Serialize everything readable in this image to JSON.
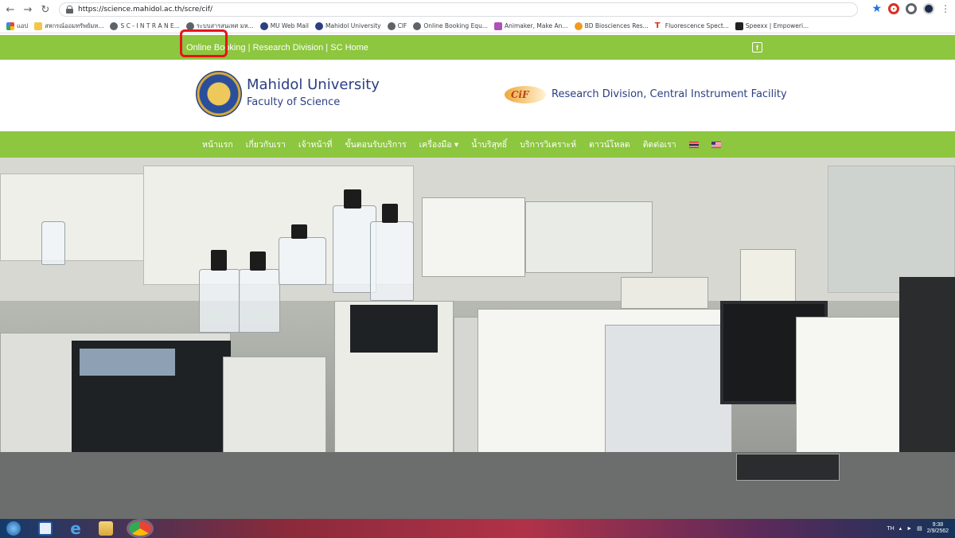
{
  "browser": {
    "url": "https://science.mahidol.ac.th/scre/cif/",
    "bookmarks": [
      "แอป",
      "สหกรณ์ออมทรัพย์มห...",
      "S C - I N T R A N E...",
      "ระบบสารสนเทศ มห...",
      "MU Web Mail",
      "Mahidol University",
      "CIF",
      "Online Booking Equ...",
      "Animaker, Make An...",
      "BD Biosciences Res...",
      "Fluorescence Spect...",
      "Speexx | Empoweri..."
    ]
  },
  "topbar": {
    "link_booking": "Online Booking",
    "separator": " | ",
    "link_research": "Research Division",
    "separator2": " | ",
    "link_home": "SC Home",
    "facebook_glyph": "f"
  },
  "header": {
    "university": "Mahidol University",
    "faculty": "Faculty of Science",
    "cif_logo_text": "CiF",
    "division": "Research Division, Central Instrument Facility"
  },
  "mainnav": {
    "items": [
      "หน้าแรก",
      "เกี่ยวกับเรา",
      "เจ้าหน้าที่",
      "ขั้นตอนรับบริการ",
      "เครื่องมือ ▾",
      "น้ำบริสุทธิ์",
      "บริการวิเคราะห์",
      "ดาวน์โหลด",
      "ติดต่อเรา"
    ]
  },
  "taskbar": {
    "lang": "TH",
    "time": "9:38",
    "date": "2/9/2562"
  }
}
